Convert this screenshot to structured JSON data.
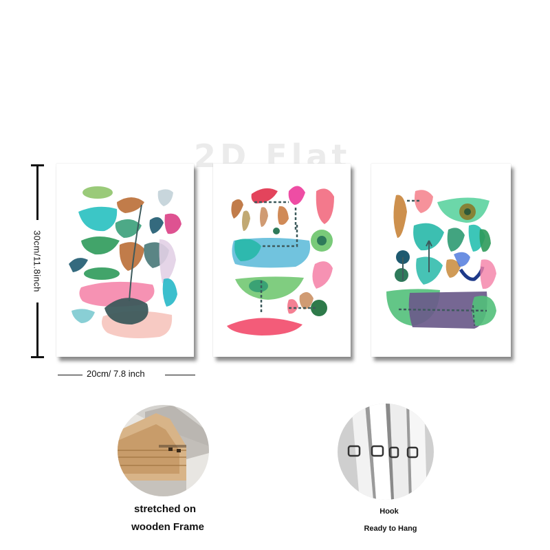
{
  "watermark": "2D Flat",
  "dimensions": {
    "height_label": "30cm/11.8inch",
    "width_label": "20cm/ 7.8 inch"
  },
  "features": [
    {
      "icon": "wooden-frame-corner-photo",
      "lines": [
        "stretched on",
        "wooden Frame"
      ]
    },
    {
      "icon": "hanging-hook-photo",
      "lines": [
        "Hook",
        "Ready to Hang"
      ]
    }
  ],
  "colors": {
    "teal": "#27b8b0",
    "green": "#3aa65a",
    "pink": "#f47fa6",
    "rust": "#b6652a",
    "slate": "#3d5a5c",
    "purple": "#6a5a8a"
  }
}
